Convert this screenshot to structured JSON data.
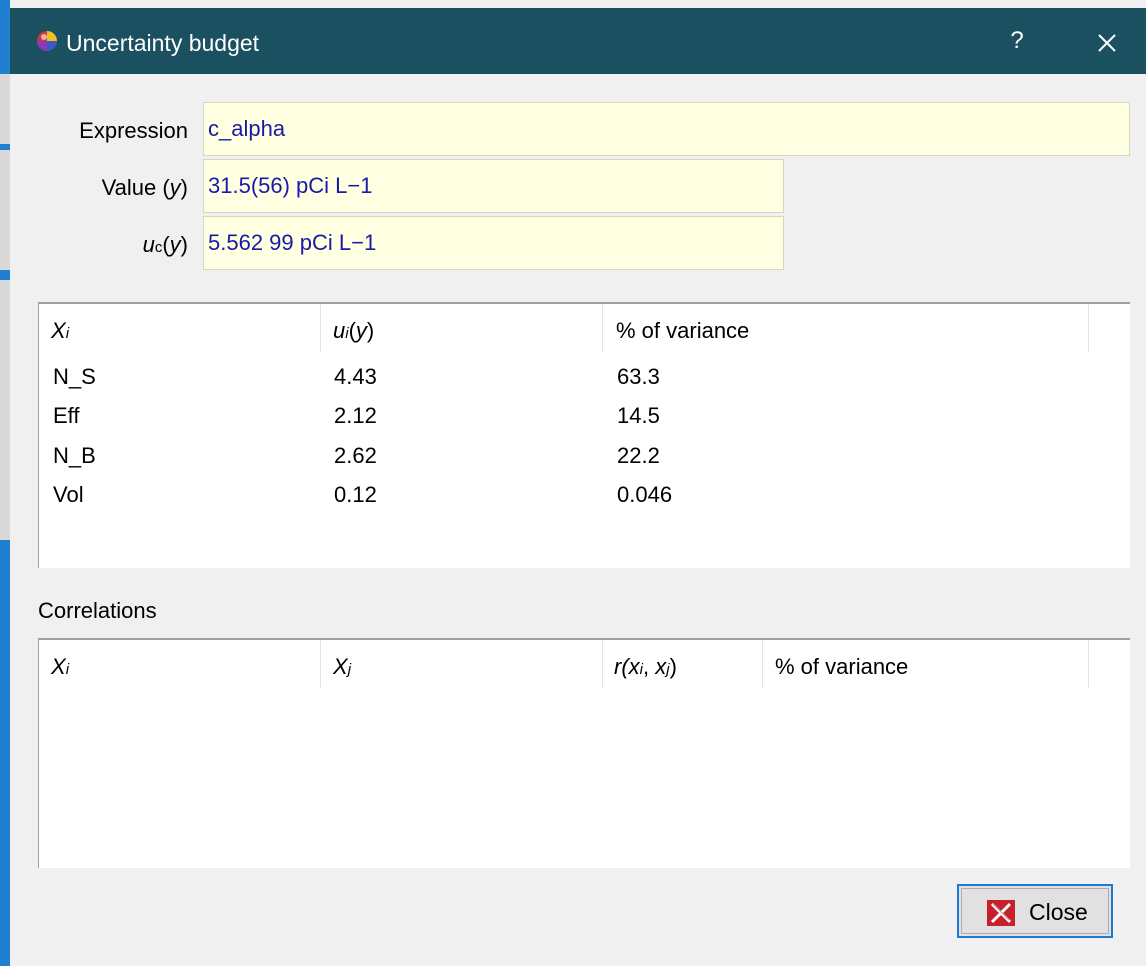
{
  "window": {
    "title": "Uncertainty budget",
    "help_label": "?",
    "close_icon": "close-icon"
  },
  "form": {
    "expression": {
      "label": "Expression",
      "value": "c_alpha"
    },
    "value": {
      "label_prefix": "Value (",
      "label_var": "y",
      "label_suffix": ")",
      "value": "31.5(56) pCi L−1"
    },
    "uc": {
      "label_u": "u",
      "label_sub": "c",
      "label_mid": "(",
      "label_var": "y",
      "label_end": ")",
      "value": "5.562 99 pCi L−1"
    }
  },
  "budget": {
    "headers": {
      "xi": "X",
      "xi_sub": "i",
      "ui_u": "u",
      "ui_sub": "i",
      "ui_paren_open": "(",
      "ui_var": "y",
      "ui_paren_close": ")",
      "variance": "% of variance"
    },
    "rows": [
      {
        "name": "N_S",
        "ui": "4.43",
        "variance": "63.3"
      },
      {
        "name": "Eff",
        "ui": "2.12",
        "variance": "14.5"
      },
      {
        "name": "N_B",
        "ui": "2.62",
        "variance": "22.2"
      },
      {
        "name": "Vol",
        "ui": "0.12",
        "variance": "0.046"
      }
    ]
  },
  "correlations": {
    "label": "Correlations",
    "headers": {
      "xi": "X",
      "xi_sub": "i",
      "xj": "X",
      "xj_sub": "j",
      "r_prefix": "r(",
      "r_x1": "x",
      "r_sub1": "i",
      "r_comma": ", ",
      "r_x2": "x",
      "r_sub2": "j",
      "r_suffix": ")",
      "variance": "% of variance"
    },
    "rows": []
  },
  "buttons": {
    "close_label": "Close",
    "close_icon": "red-x-icon"
  },
  "colors": {
    "titlebar": "#1b5060",
    "field_bg": "#ffffe1",
    "field_text": "#1a1aa8",
    "accent": "#1a7ad4"
  }
}
